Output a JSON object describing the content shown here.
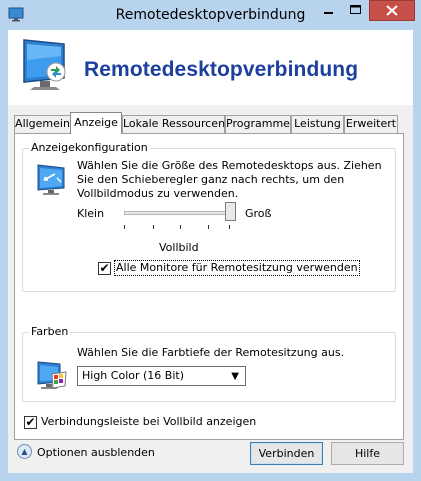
{
  "window": {
    "title": "Remotedesktopverbindung",
    "min_icon": "minimize-icon",
    "max_icon": "maximize-icon",
    "close_icon": "close-icon",
    "accent_close": "#c7504b",
    "frame_color": "#b8d3ee"
  },
  "banner": {
    "title": "Remotedesktopverbindung",
    "title_color": "#1d3f9e",
    "icon": "remote-desktop-icon"
  },
  "tabs": [
    {
      "label": "Allgemein",
      "active": false
    },
    {
      "label": "Anzeige",
      "active": true
    },
    {
      "label": "Lokale Ressourcen",
      "active": false
    },
    {
      "label": "Programme",
      "active": false
    },
    {
      "label": "Leistung",
      "active": false
    },
    {
      "label": "Erweitert",
      "active": false
    }
  ],
  "display_group": {
    "title": "Anzeigekonfiguration",
    "icon": "monitor-resolution-icon",
    "description": "Wählen Sie die Größe des Remotedesktops aus. Ziehen Sie den Schieberegler ganz nach rechts, um den Vollbildmodus zu verwenden.",
    "slider_min_label": "Klein",
    "slider_max_label": "Groß",
    "slider_value_label": "Vollbild",
    "slider_position": 1.0,
    "multi_monitor_label": "Alle Monitore für Remotesitzung verwenden",
    "multi_monitor_checked": true
  },
  "colors_group": {
    "title": "Farben",
    "icon": "color-palette-monitor-icon",
    "description": "Wählen Sie die Farbtiefe der Remotesitzung aus.",
    "depth_selected": "High Color (16 Bit)"
  },
  "connection_bar": {
    "label": "Verbindungsleiste bei Vollbild anzeigen",
    "checked": true
  },
  "footer": {
    "options_label": "Optionen ausblenden",
    "options_icon": "collapse-up-icon",
    "connect_label": "Verbinden",
    "help_label": "Hilfe"
  }
}
